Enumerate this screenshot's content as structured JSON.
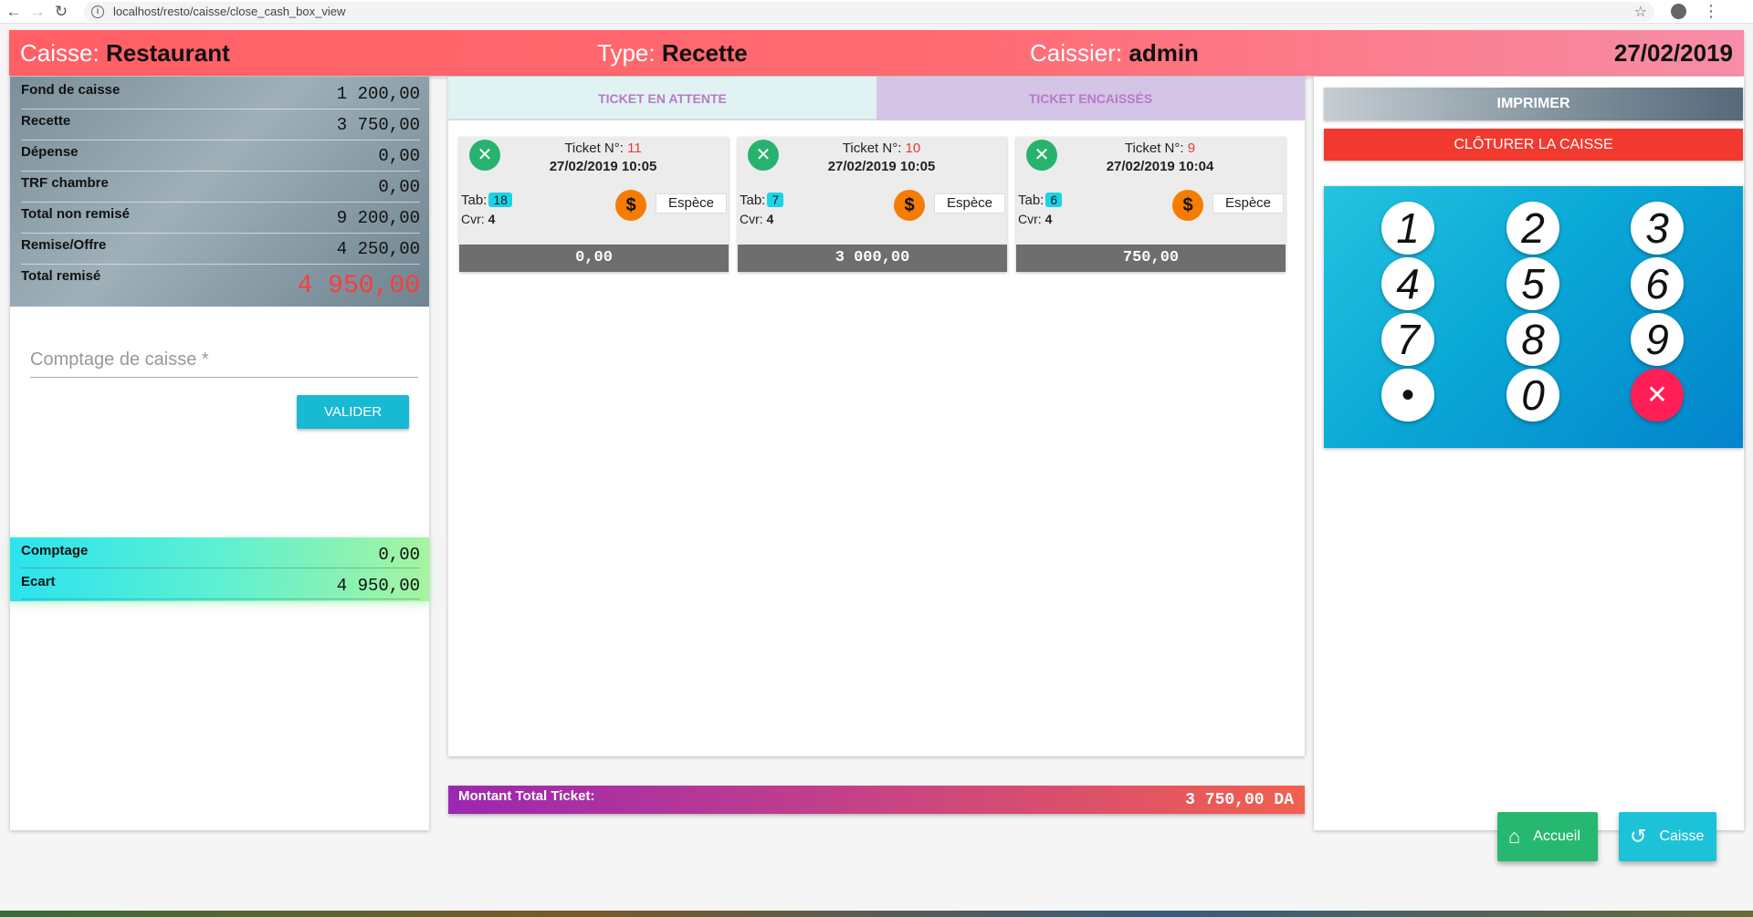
{
  "browser": {
    "url": "localhost/resto/caisse/close_cash_box_view"
  },
  "header": {
    "caisse_label": "Caisse:",
    "caisse_value": "Restaurant",
    "type_label": "Type:",
    "type_value": "Recette",
    "caissier_label": "Caissier:",
    "caissier_value": "admin",
    "date": "27/02/2019"
  },
  "summary": {
    "rows": [
      {
        "label": "Fond de caisse",
        "value": "1 200,00"
      },
      {
        "label": "Recette",
        "value": "3 750,00"
      },
      {
        "label": "Dépense",
        "value": "0,00"
      },
      {
        "label": "TRF chambre",
        "value": "0,00"
      },
      {
        "label": "Total non remisé",
        "value": "9 200,00"
      },
      {
        "label": "Remise/Offre",
        "value": "4 250,00"
      }
    ],
    "total_label": "Total remisé",
    "total_value": "4 950,00"
  },
  "count_form": {
    "placeholder": "Comptage de caisse *",
    "submit_label": "VALIDER"
  },
  "diff": {
    "comptage_label": "Comptage",
    "comptage_value": "0,00",
    "ecart_label": "Ecart",
    "ecart_value": "4 950,00"
  },
  "tabs": {
    "pending": "TICKET EN ATTENTE",
    "paid": "TICKET ENCAISSÉS"
  },
  "tickets": [
    {
      "number_label": "Ticket N°:",
      "number": "11",
      "date": "27/02/2019 10:05",
      "tab_label": "Tab:",
      "tab": "18",
      "cvr_label": "Cvr:",
      "cvr": "4",
      "payment": "Espèce",
      "amount": "0,00"
    },
    {
      "number_label": "Ticket N°:",
      "number": "10",
      "date": "27/02/2019 10:05",
      "tab_label": "Tab:",
      "tab": "7",
      "cvr_label": "Cvr:",
      "cvr": "4",
      "payment": "Espèce",
      "amount": "3 000,00"
    },
    {
      "number_label": "Ticket N°:",
      "number": "9",
      "date": "27/02/2019 10:04",
      "tab_label": "Tab:",
      "tab": "6",
      "cvr_label": "Cvr:",
      "cvr": "4",
      "payment": "Espèce",
      "amount": "750,00"
    }
  ],
  "ticket_total": {
    "label": "Montant Total Ticket:",
    "value": "3 750,00 DA"
  },
  "actions": {
    "print": "IMPRIMER",
    "close": "CLÔTURER LA CAISSE"
  },
  "keypad": {
    "keys": [
      "1",
      "2",
      "3",
      "4",
      "5",
      "6",
      "7",
      "8",
      "9",
      "•",
      "0",
      "✕"
    ]
  },
  "footer_buttons": {
    "home": "Accueil",
    "caisse": "Caisse"
  },
  "icons": {
    "ticket": "utensils-icon",
    "payment": "dollar-icon",
    "home": "home-icon",
    "caisse": "undo-icon"
  },
  "colors": {
    "header_start": "#ff5f65",
    "header_end": "#f78da7",
    "close_button": "#f2392f",
    "validate_button": "#17b9d3",
    "ticket_icon": "#27b36e",
    "payment_icon": "#f57c00",
    "keypad_clear": "#ff1f56",
    "accent_red": "#ff3b3b"
  }
}
